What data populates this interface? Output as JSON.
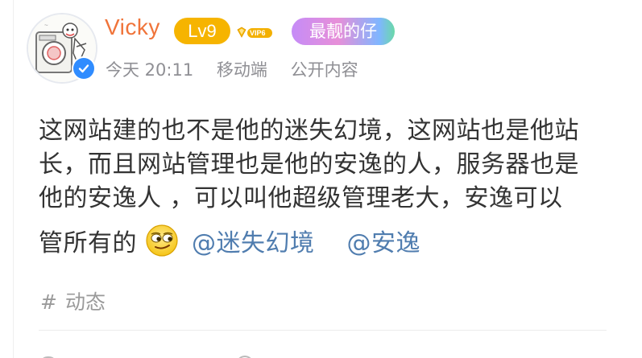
{
  "post": {
    "author": {
      "name": "Vicky",
      "level": "Lv9",
      "vip": "VIP6",
      "title_badge": "最靓的仔"
    },
    "meta": {
      "time": "今天 20:11",
      "source": "移动端",
      "visibility": "公开内容"
    },
    "content": {
      "text_lines": [
        "这网站建的也不是他的迷失幻境，这网站也是他站",
        "长，而且网站管理也是他的安逸的人，服务器也是",
        "他的安逸人 ，可以叫他超级管理老大，安逸可以",
        "管所有的"
      ],
      "emoji": "smirk-emoji",
      "mentions": [
        "@迷失幻境",
        "@安逸"
      ]
    },
    "tag": {
      "symbol": "#",
      "label": "动态"
    }
  },
  "colors": {
    "username": "#f0743a",
    "level_badge": "#f6b400",
    "mention": "#507daf",
    "verify": "#2f8cff"
  }
}
